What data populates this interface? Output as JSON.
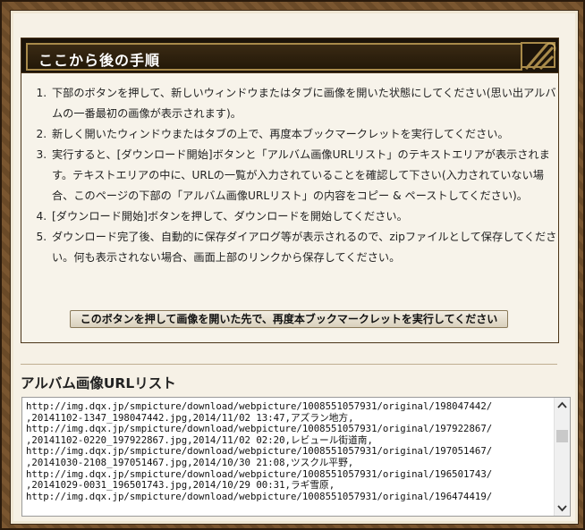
{
  "steps_box": {
    "title": "ここから後の手順",
    "steps": [
      "下部のボタンを押して、新しいウィンドウまたはタブに画像を開いた状態にしてください(思い出アルバムの一番最初の画像が表示されます)。",
      "新しく開いたウィンドウまたはタブの上で、再度本ブックマークレットを実行してください。",
      "実行すると、[ダウンロード開始]ボタンと「アルバム画像URLリスト」のテキストエリアが表示されます。テキストエリアの中に、URLの一覧が入力されていることを確認して下さい(入力されていない場合、このページの下部の「アルバム画像URLリスト」の内容をコピー & ペーストしてください)。",
      "[ダウンロード開始]ボタンを押して、ダウンロードを開始してください。",
      "ダウンロード完了後、自動的に保存ダイアログ等が表示されるので、zipファイルとして保存してください。何も表示されない場合、画面上部のリンクから保存してください。"
    ],
    "action_button": "このボタンを押して画像を開いた先で、再度本ブックマークレットを実行してください"
  },
  "url_list": {
    "title": "アルバム画像URLリスト",
    "content": "http://img.dqx.jp/smpicture/download/webpicture/1008551057931/original/198047442/\n,20141102-1347_198047442.jpg,2014/11/02 13:47,アズラン地方,\nhttp://img.dqx.jp/smpicture/download/webpicture/1008551057931/original/197922867/\n,20141102-0220_197922867.jpg,2014/11/02 02:20,レビュール街道南,\nhttp://img.dqx.jp/smpicture/download/webpicture/1008551057931/original/197051467/\n,20141030-2108_197051467.jpg,2014/10/30 21:08,ツスクル平野,\nhttp://img.dqx.jp/smpicture/download/webpicture/1008551057931/original/196501743/\n,20141029-0031_196501743.jpg,2014/10/29 00:31,ラギ雪原,\nhttp://img.dqx.jp/smpicture/download/webpicture/1008551057931/original/196474419/"
  },
  "icons": {
    "scroll_up": "chevron-up-icon",
    "scroll_down": "chevron-down-icon",
    "corner": "ornament-icon"
  },
  "colors": {
    "frame": "#6b4a2a",
    "header": "#1c140a",
    "header_border": "#a88a4a",
    "panel": "#f6f1e6"
  }
}
